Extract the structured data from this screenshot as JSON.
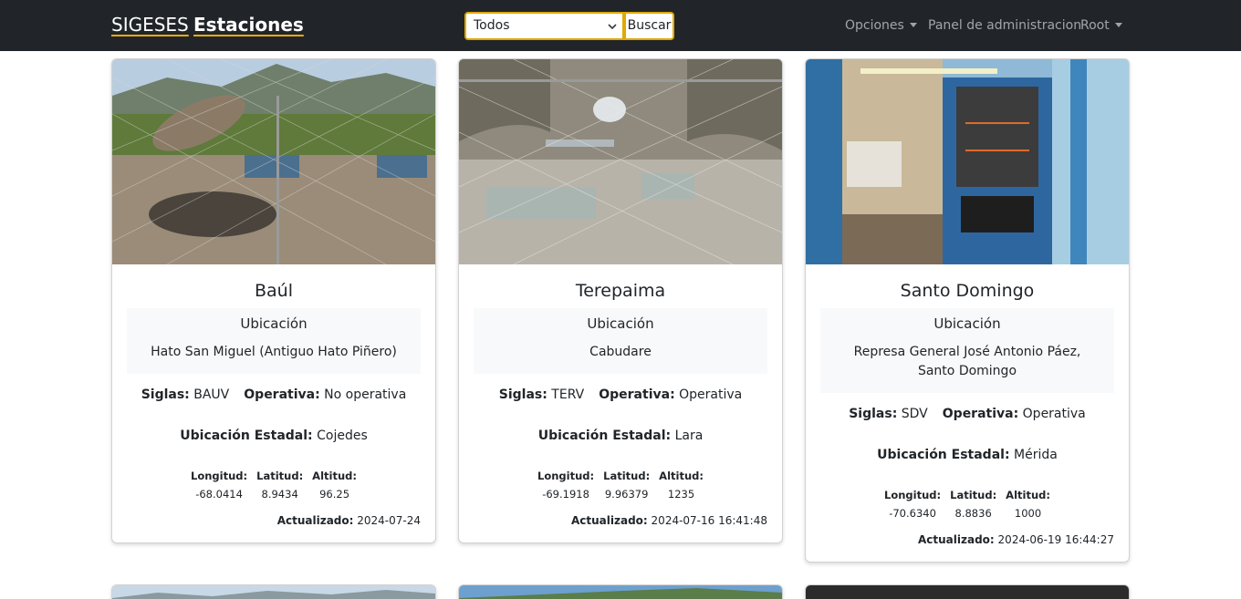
{
  "navbar": {
    "brand": "SIGESES",
    "section": "Estaciones",
    "filter_value": "Todos",
    "search_label": "Buscar",
    "links": [
      "Opciones",
      "Panel de administracion",
      "Root"
    ]
  },
  "labels": {
    "ubicacion": "Ubicación",
    "siglas": "Siglas:",
    "operativa": "Operativa:",
    "ubicacion_estadal": "Ubicación Estadal:",
    "longitud": "Longitud:",
    "latitud": "Latitud:",
    "altitud": "Altitud:",
    "actualizado": "Actualizado:"
  },
  "stations": [
    {
      "name": "Baúl",
      "location": "Hato San Miguel (Antiguo Hato Piñero)",
      "siglas": "BAUV",
      "operativa": "No operativa",
      "estado": "Cojedes",
      "longitud": "-68.0414",
      "latitud": "8.9434",
      "altitud": "96.25",
      "actualizado": "2024-07-24"
    },
    {
      "name": "Terepaima",
      "location": "Cabudare",
      "siglas": "TERV",
      "operativa": "Operativa",
      "estado": "Lara",
      "longitud": "-69.1918",
      "latitud": "9.96379",
      "altitud": "1235",
      "actualizado": "2024-07-16 16:41:48"
    },
    {
      "name": "Santo Domingo",
      "location": "Represa General José Antonio Páez, Santo Domingo",
      "siglas": "SDV",
      "operativa": "Operativa",
      "estado": "Mérida",
      "longitud": "-70.6340",
      "latitud": "8.8836",
      "altitud": "1000",
      "actualizado": "2024-06-19 16:44:27"
    }
  ],
  "colors": {
    "navbar": "#212529",
    "accent": "#e0a800"
  }
}
